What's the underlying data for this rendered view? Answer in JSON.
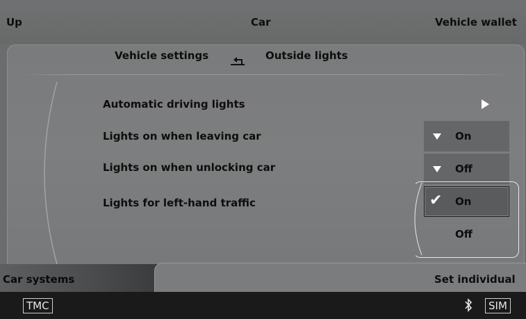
{
  "header": {
    "left": "Up",
    "center": "Car",
    "right": "Vehicle wallet"
  },
  "breadcrumb": {
    "parent": "Vehicle settings",
    "current": "Outside lights",
    "back_icon": "return-arrow-icon"
  },
  "rows": [
    {
      "label": "Automatic driving lights",
      "control": "submenu-arrow"
    },
    {
      "label": "Lights on when leaving car",
      "value": "On"
    },
    {
      "label": "Lights on when unlocking car",
      "value": "Off"
    },
    {
      "label": "Lights for left-hand traffic"
    }
  ],
  "popup": {
    "options": [
      "On",
      "Off"
    ],
    "selected": "On"
  },
  "footer": {
    "left": "Car systems",
    "right": "Set individual"
  },
  "status": {
    "left_badge": "TMC",
    "right_badge": "SIM",
    "bluetooth_icon": "bluetooth-icon"
  },
  "colors": {
    "background": "#6b6c6d",
    "text": "#0d0d0d",
    "status_bar": "#1a1a1a"
  }
}
